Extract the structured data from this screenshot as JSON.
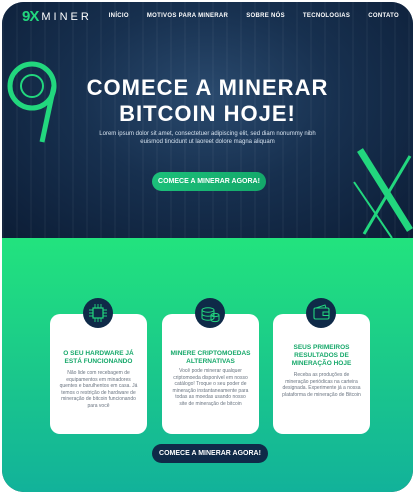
{
  "brand": {
    "mark": "9X",
    "name": "MINER"
  },
  "nav": {
    "items": [
      "INÍCIO",
      "MOTIVOS PARA MINERAR",
      "SOBRE NÓS",
      "TECNOLOGIAS",
      "CONTATO"
    ]
  },
  "hero": {
    "title_line1": "COMECE A MINERAR",
    "title_line2": "BITCOIN HOJE!",
    "subtitle": "Lorem ipsum dolor sit amet, consectetuer adipiscing elit, sed diam nonummy nibh euismod tincidunt ut laoreet dolore magna aliquam",
    "cta": "COMECE A MINERAR AGORA!"
  },
  "cards": [
    {
      "icon": "chip-icon",
      "title": "O SEU HARDWARE JÁ ESTÁ FUNCIONANDO",
      "text": "Não lide com recebagem de equipamentos em minadores quentes e barulhentos em casa. Já temos o restrição de hardware de mineração de bitcoin funcionando para você"
    },
    {
      "icon": "coins-icon",
      "title": "MINERE CRIPTOMOEDAS ALTERNATIVAS",
      "text": "Você pode minerar qualquer criptomoeda disponível em nosso catálogo! Troque o seu poder de mineração instantaneamente para todas as moedas usando nosso site de mineração de bitcoin"
    },
    {
      "icon": "wallet-icon",
      "title": "SEUS PRIMEIROS RESULTADOS DE MINERAÇÃO HOJE",
      "text": "Receba as produções de mineração periódicas na carteira designada. Experimente já a nossa plataforma de mineração de Bitcoin"
    }
  ],
  "section": {
    "cta": "COMECE A MINERAR AGORA!"
  },
  "colors": {
    "accent": "#22d77e",
    "navy": "#0f2a48",
    "green_bg": "#1bc98a"
  }
}
